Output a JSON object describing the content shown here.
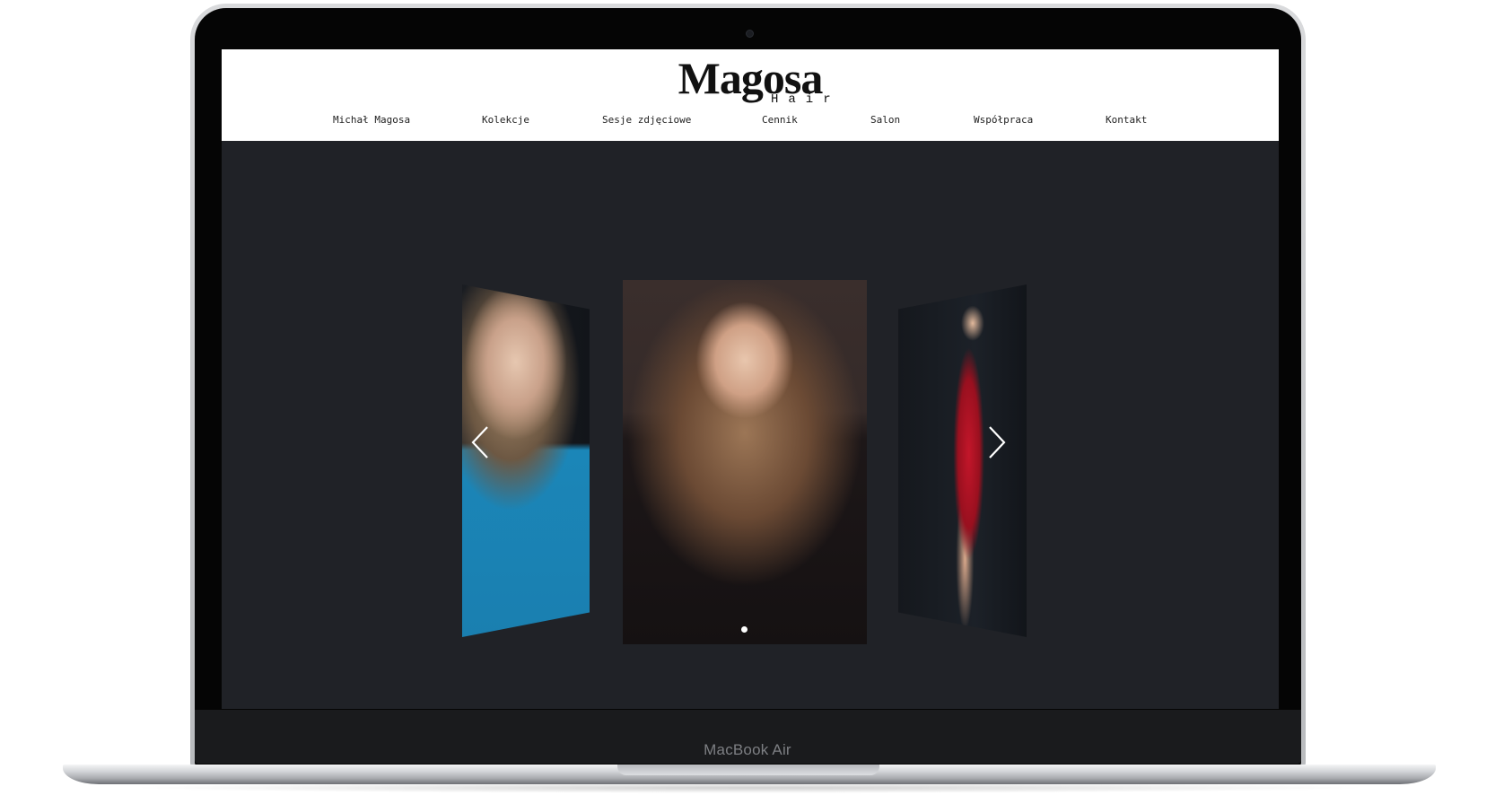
{
  "device": {
    "label": "MacBook Air"
  },
  "site": {
    "logo": {
      "main": "Magosa",
      "sub": "Hair"
    },
    "nav": [
      {
        "label": "Michał Magosa"
      },
      {
        "label": "Kolekcje"
      },
      {
        "label": "Sesje zdjęciowe"
      },
      {
        "label": "Cennik"
      },
      {
        "label": "Salon"
      },
      {
        "label": "Współpraca"
      },
      {
        "label": "Kontakt"
      }
    ]
  },
  "carousel": {
    "slides": [
      {
        "description_icon": "portrait-photo-blue-dress"
      },
      {
        "description_icon": "portrait-photo-black-dress"
      },
      {
        "description_icon": "portrait-photo-red-dress"
      }
    ],
    "active_index": 1,
    "dot_count": 1,
    "prev_icon": "chevron-left-icon",
    "next_icon": "chevron-right-icon"
  },
  "colors": {
    "header_bg": "#ffffff",
    "page_bg": "#202227",
    "text": "#222222",
    "arrow": "#ffffff"
  }
}
